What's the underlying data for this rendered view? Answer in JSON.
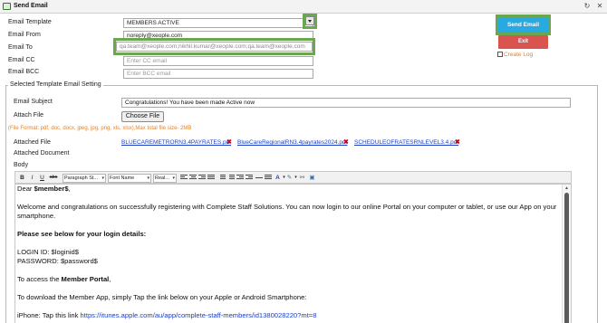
{
  "window": {
    "title": "Send Email"
  },
  "form": {
    "template_label": "Email Template",
    "template_value": "MEMBERS ACTIVE",
    "from_label": "Email From",
    "from_value": "noreply@xeople.com",
    "to_label": "Email To",
    "to_value": "qa.team@xeople.com;nikhil.kumar@xeople.com;qa.team@xeople.com",
    "cc_label": "Email CC",
    "cc_placeholder": "Enter CC email",
    "bcc_label": "Email BCC",
    "bcc_placeholder": "Enter BCC email"
  },
  "actions": {
    "send_label": "Send Email",
    "exit_label": "Exit",
    "create_log_label": "Create Log"
  },
  "template_section": {
    "legend": "Selected Template Email Setting",
    "subject_label": "Email Subject",
    "subject_value": "Congratulations! You have been made Active now",
    "attach_label": "Attach File",
    "choose_file_label": "Choose File",
    "format_note": "(File Format: pdf, doc, docx, jpeg, jpg, png, xls, xlsx),Max total file size- 2MB",
    "attached_label": "Attached File",
    "attached_files": [
      "BLUECAREMETRORN3.4PAYRATES.pdf",
      "BlueCareRegionalRN3.4payrates2024.pdf",
      "SCHEDULEOFRATESRNLEVEL3.4.pdf"
    ],
    "attached_doc_label": "Attached Document",
    "body_label": "Body"
  },
  "toolbar": {
    "bold": "B",
    "italic": "I",
    "underline": "U",
    "strike": "abc",
    "paragraph_style": "Paragraph St...",
    "font_name": "Font Name",
    "font_size": "Real..."
  },
  "editor": {
    "lines": {
      "greeting_a": "Dear ",
      "greeting_b": "$member$",
      "greeting_c": ",",
      "welcome_1": "Welcome and congratulations on successfully registering with Complete Staff Solutions. You can now login to our online Portal on your computer or tablet, or use our App on your",
      "welcome_2": "smartphone.",
      "login_heading": "Please see below for your login details:",
      "login_id": "LOGIN ID: $loginid$",
      "password": "PASSWORD: $password$",
      "portal_a": "To access the ",
      "portal_b": "Member Portal",
      "portal_c": ",",
      "app_line": "To download the Member App, simply Tap the link below on your Apple or Android Smartphone:",
      "iphone_a": "iPhone:  Tap this link ",
      "iphone_link": "https://itunes.apple.com/au/app/complete-staff-members/id1380028220?mt=8"
    }
  }
}
